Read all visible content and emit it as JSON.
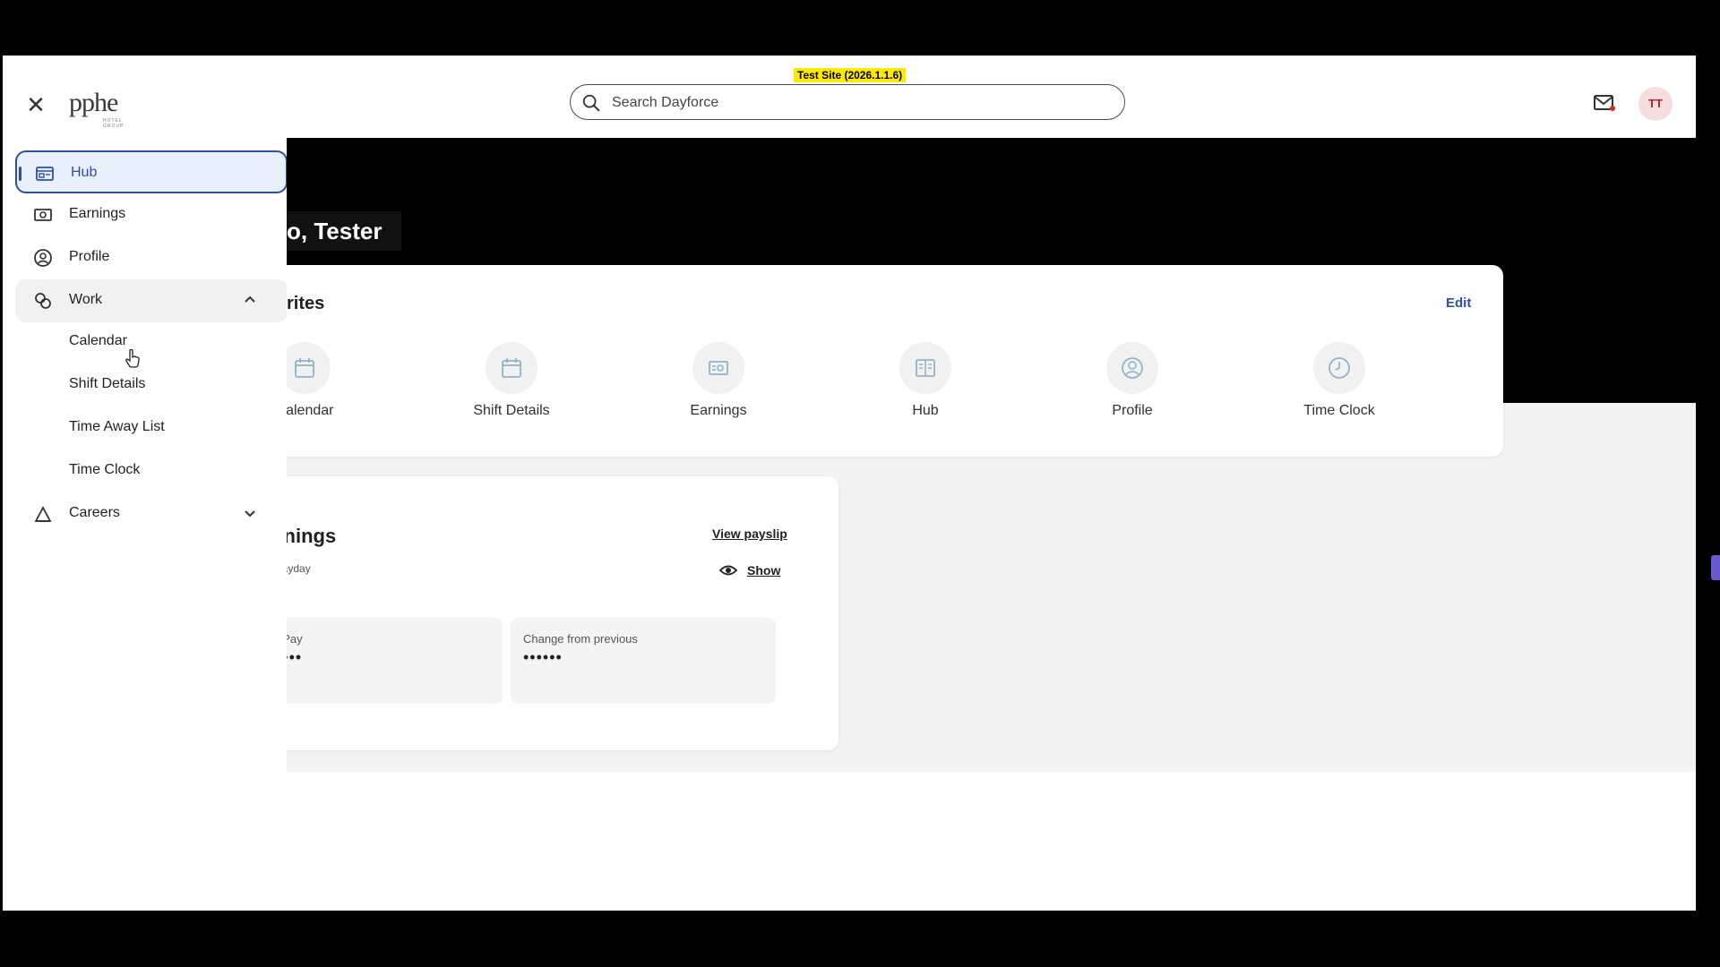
{
  "header": {
    "test_badge": "Test Site (2026.1.1.6)",
    "logo_text": "pphe",
    "logo_sub": "HOTEL GROUP",
    "search_placeholder": "Search Dayforce",
    "avatar_initials": "TT"
  },
  "sidebar": {
    "items": [
      {
        "label": "Hub"
      },
      {
        "label": "Earnings"
      },
      {
        "label": "Profile"
      },
      {
        "label": "Work"
      },
      {
        "label": "Careers"
      }
    ],
    "work_sub": [
      "Calendar",
      "Shift Details",
      "Time Away List",
      "Time Clock"
    ]
  },
  "main": {
    "greeting": "o, Tester",
    "favorites": {
      "title": "rites",
      "edit": "Edit",
      "items": [
        {
          "label": "Calendar",
          "icon": "calendar-icon"
        },
        {
          "label": "Shift Details",
          "icon": "calendar-icon"
        },
        {
          "label": "Earnings",
          "icon": "earnings-icon"
        },
        {
          "label": "Hub",
          "icon": "hub-icon"
        },
        {
          "label": "Profile",
          "icon": "profile-icon"
        },
        {
          "label": "Time Clock",
          "icon": "clock-icon"
        }
      ]
    },
    "earnings": {
      "title": "rnings",
      "view_payslip": "View payslip",
      "payday_label": "payday",
      "payday_value": "-",
      "show": "Show",
      "tiles": [
        {
          "label": "t Pay",
          "value": "••••"
        },
        {
          "label": "Change from previous",
          "value": "••••••"
        }
      ]
    }
  },
  "colors": {
    "accent": "#2e4fa3",
    "badge": "#ffe900",
    "icon_muted": "#8fb5c9"
  }
}
